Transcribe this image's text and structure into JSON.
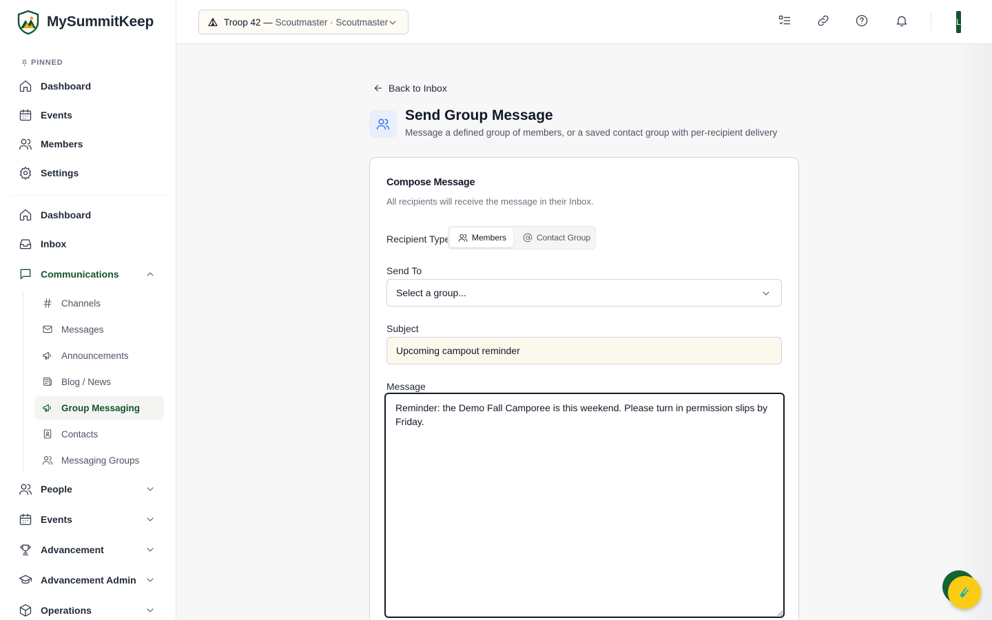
{
  "app": {
    "name": "MySummitKeep",
    "brand_color": "#14532d"
  },
  "sidebar": {
    "pinned_label": "PINNED",
    "pinned": [
      {
        "label": "Dashboard",
        "icon": "home-icon"
      },
      {
        "label": "Events",
        "icon": "calendar-icon"
      },
      {
        "label": "Members",
        "icon": "users-icon"
      },
      {
        "label": "Settings",
        "icon": "gear-icon"
      }
    ],
    "main": [
      {
        "label": "Dashboard",
        "icon": "home-icon"
      },
      {
        "label": "Inbox",
        "icon": "inbox-icon"
      },
      {
        "label": "Communications",
        "icon": "message-square-icon",
        "expanded": true
      }
    ],
    "communications_children": [
      {
        "label": "Channels",
        "icon": "hash-icon"
      },
      {
        "label": "Messages",
        "icon": "mail-icon"
      },
      {
        "label": "Announcements",
        "icon": "megaphone-icon"
      },
      {
        "label": "Blog / News",
        "icon": "newspaper-icon"
      },
      {
        "label": "Group Messaging",
        "icon": "megaphone-icon",
        "active": true
      },
      {
        "label": "Contacts",
        "icon": "contact-icon"
      },
      {
        "label": "Messaging Groups",
        "icon": "users-icon"
      }
    ],
    "sections": [
      {
        "label": "People",
        "icon": "users-icon"
      },
      {
        "label": "Events",
        "icon": "calendar-icon"
      },
      {
        "label": "Advancement",
        "icon": "trophy-icon"
      },
      {
        "label": "Advancement Admin",
        "icon": "graduation-cap-icon"
      },
      {
        "label": "Operations",
        "icon": "box-icon"
      }
    ]
  },
  "topbar": {
    "unit": "Troop 42",
    "separator": " — ",
    "role": "Scoutmaster · Scoutmaster",
    "icons": [
      "checklist-icon",
      "link-icon",
      "help-icon",
      "bell-icon"
    ],
    "avatar_initial": "L"
  },
  "page": {
    "back_label": "Back to Inbox",
    "title": "Send Group Message",
    "subtitle": "Message a defined group of members, or a saved contact group with per-recipient delivery"
  },
  "compose": {
    "title": "Compose Message",
    "description": "All recipients will receive the message in their Inbox.",
    "recipient_type_label": "Recipient Type",
    "recipient_types": [
      {
        "label": "Members",
        "icon": "users-icon",
        "selected": true
      },
      {
        "label": "Contact Group",
        "icon": "at-sign-icon",
        "selected": false
      }
    ],
    "send_to_label": "Send To",
    "send_to_value": "Select a group...",
    "subject_label": "Subject",
    "subject_value": "Upcoming campout reminder",
    "message_label": "Message",
    "message_value": "Reminder: the Demo Fall Camporee is this weekend. Please turn in permission slips by Friday."
  }
}
